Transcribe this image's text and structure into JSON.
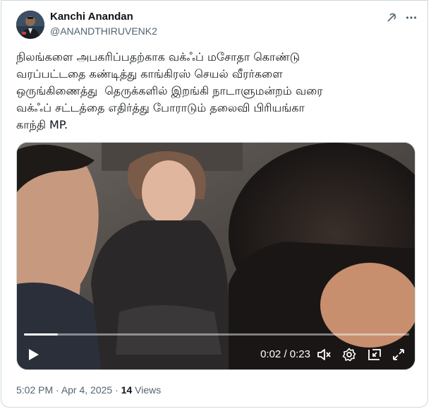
{
  "author": {
    "name": "Kanchi Anandan",
    "handle": "@ANANDTHIRUVENK2",
    "avatar_icon": "avatar-photo"
  },
  "header_icons": [
    "grok-icon",
    "more-options-icon"
  ],
  "tweet": {
    "text": "நிலங்களை அபகரிப்பதற்காக வக்ஃப் மசோதா கொண்டு\nவரப்பட்டதை கண்டித்து காங்கிரஸ் செயல் வீரர்களை\nஒருங்கிணைத்து  தெருக்களில் இறங்கி நாடாளுமன்றம் வரை\nவக்ஃப் சட்டத்தை எதிர்த்து போராடும் தலைவி பிரியங்கா\nகாந்தி MP."
  },
  "video": {
    "progress_fraction": 0.087,
    "current_time": "0:02",
    "separator": " / ",
    "duration": "0:23",
    "controls": [
      "play-icon",
      "volume-muted-icon",
      "settings-icon",
      "picture-in-picture-icon",
      "fullscreen-icon"
    ]
  },
  "meta": {
    "time": "5:02 PM",
    "dot1": " · ",
    "date": "Apr 4, 2025",
    "dot2": " · ",
    "views_count": "14",
    "views_label": " Views"
  },
  "colors": {
    "text_primary": "#0f1419",
    "text_secondary": "#536471",
    "border": "#cfd9de"
  }
}
